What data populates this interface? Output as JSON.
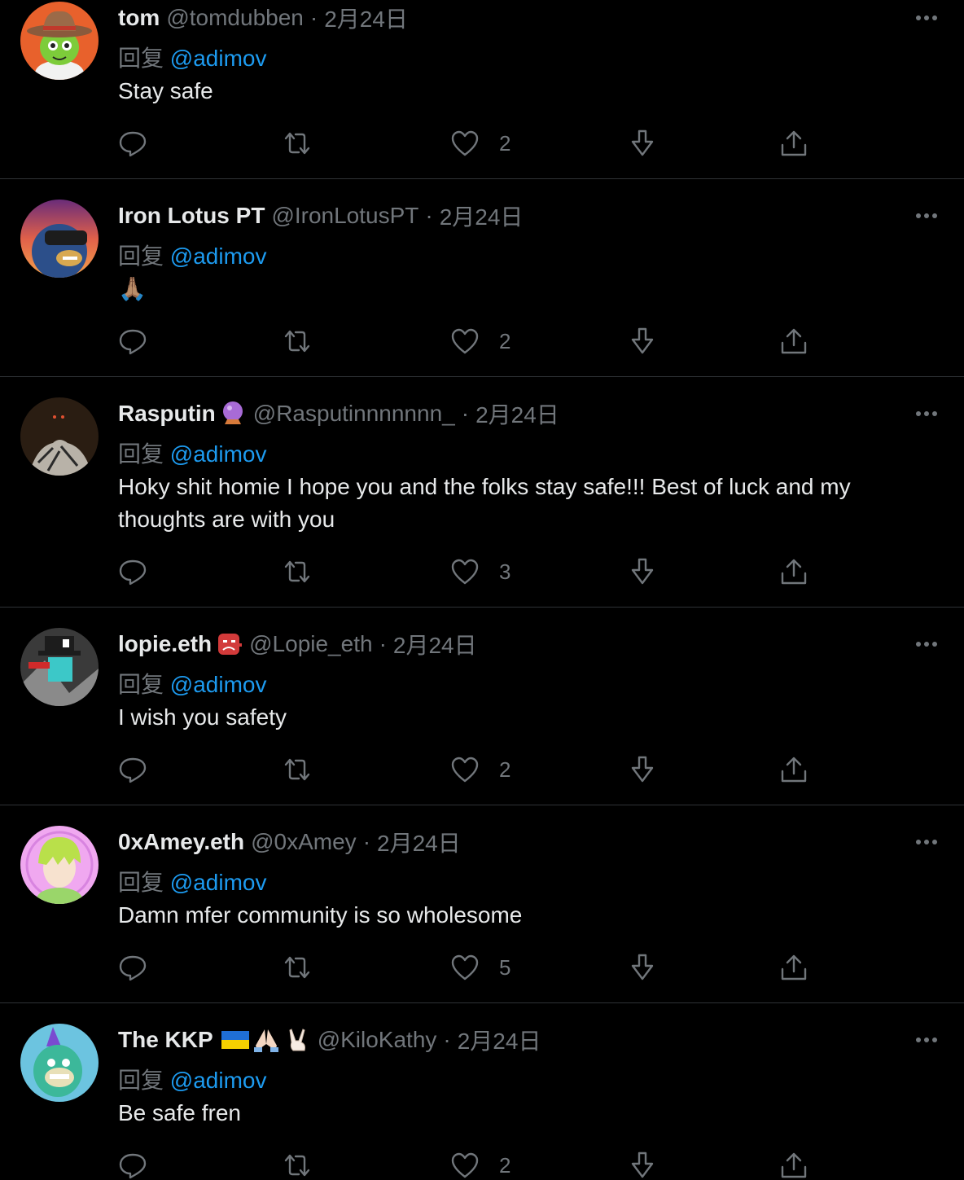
{
  "reply_prefix": "回复",
  "colors": {
    "background": "#000000",
    "text": "#e7e9ea",
    "muted": "#71767b",
    "link": "#1d9bf0",
    "divider": "#2f3336"
  },
  "icons": [
    "more-icon",
    "reply-icon",
    "retweet-icon",
    "like-icon",
    "downvote-icon",
    "share-icon"
  ],
  "tweets": [
    {
      "name": "tom",
      "name_emojis": [],
      "handle": "@tomdubben",
      "separator": "·",
      "date": "2月24日",
      "reply_to": "@adimov",
      "text": "Stay safe",
      "likes": "2",
      "avatar": "cowboy-hat-character-avatar"
    },
    {
      "name": "Iron Lotus PT",
      "name_emojis": [],
      "handle": "@IronLotusPT",
      "separator": "·",
      "date": "2月24日",
      "reply_to": "@adimov",
      "text": "🙏🏽",
      "likes": "2",
      "avatar": "vr-ape-avatar"
    },
    {
      "name": "Rasputin",
      "name_emojis": [
        "crystal-ball"
      ],
      "handle": "@Rasputinnnnnnn_",
      "separator": "·",
      "date": "2月24日",
      "reply_to": "@adimov",
      "text": "Hoky shit homie I hope you and the folks stay safe!!! Best of luck and my thoughts are with you",
      "likes": "3",
      "avatar": "dark-sketch-avatar"
    },
    {
      "name": "lopie.eth",
      "name_emojis": [
        "goblin"
      ],
      "handle": "@Lopie_eth",
      "separator": "·",
      "date": "2月24日",
      "reply_to": "@adimov",
      "text": "I wish you safety",
      "likes": "2",
      "avatar": "robot-hat-avatar"
    },
    {
      "name": "0xAmey.eth",
      "name_emojis": [],
      "handle": "@0xAmey",
      "separator": "·",
      "date": "2月24日",
      "reply_to": "@adimov",
      "text": "Damn mfer community is so wholesome",
      "likes": "5",
      "avatar": "anime-green-hair-avatar"
    },
    {
      "name": "The KKP",
      "name_emojis": [
        "ukraine-flag",
        "folded-hands",
        "victory-hand"
      ],
      "handle": "@KiloKathy",
      "separator": "·",
      "date": "2月24日",
      "reply_to": "@adimov",
      "text": "Be safe fren",
      "likes": "2",
      "avatar": "party-hat-ape-avatar"
    }
  ]
}
